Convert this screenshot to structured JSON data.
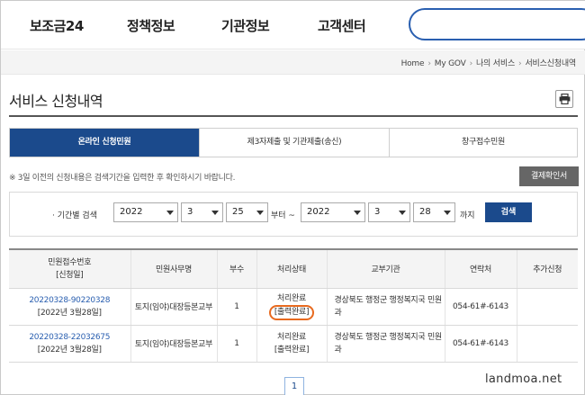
{
  "nav": {
    "logo": "보조금24",
    "items": [
      "정책정보",
      "기관정보",
      "고객센터"
    ]
  },
  "breadcrumb": [
    "Home",
    "My GOV",
    "나의 서비스",
    "서비스신청내역"
  ],
  "page_title": "서비스 신청내역",
  "tabs": [
    {
      "label": "온라인 신청민원",
      "active": true
    },
    {
      "label": "제3자제출 및 기관제출(송신)",
      "active": false
    },
    {
      "label": "창구접수민원",
      "active": false
    }
  ],
  "notice": "※ 3일 이전의 신청내용은 검색기간을 입력한 후 확인하시기 바랍니다.",
  "receipt_button": "결제확인서",
  "search": {
    "label": "· 기간별 검색",
    "from": {
      "year": "2022",
      "month": "3",
      "day": "25"
    },
    "from_suffix": "부터 ~",
    "to": {
      "year": "2022",
      "month": "3",
      "day": "28"
    },
    "to_suffix": "까지",
    "button": "검색"
  },
  "table": {
    "headers": {
      "receipt_no": "민원접수번호",
      "receipt_date": "[신청일]",
      "office": "민원사무명",
      "copies": "부수",
      "status": "처리상태",
      "agency": "교부기관",
      "contact": "연락처",
      "add": "추가신청"
    },
    "rows": [
      {
        "no": "20220328-90220328",
        "date": "[2022년 3월28일]",
        "office": "토지(임야)대장등본교부",
        "copies": "1",
        "status": "처리완료",
        "print": "[출력완료]",
        "agency": "경상북도 행정군 행정복지국 민원과",
        "contact": "054-61#-6143"
      },
      {
        "no": "20220328-22032675",
        "date": "[2022년 3월28일]",
        "office": "토지(임야)대장등본교부",
        "copies": "1",
        "status": "처리완료",
        "print": "[출력완료]",
        "agency": "경상북도 행정군 행정복지국 민원과",
        "contact": "054-61#-6143"
      }
    ]
  },
  "pager": {
    "current": "1"
  },
  "watermark": "landmoa.net",
  "colors": {
    "primary": "#1b4a8c",
    "highlight": "#e86a1f",
    "link": "#2a5fb0"
  }
}
